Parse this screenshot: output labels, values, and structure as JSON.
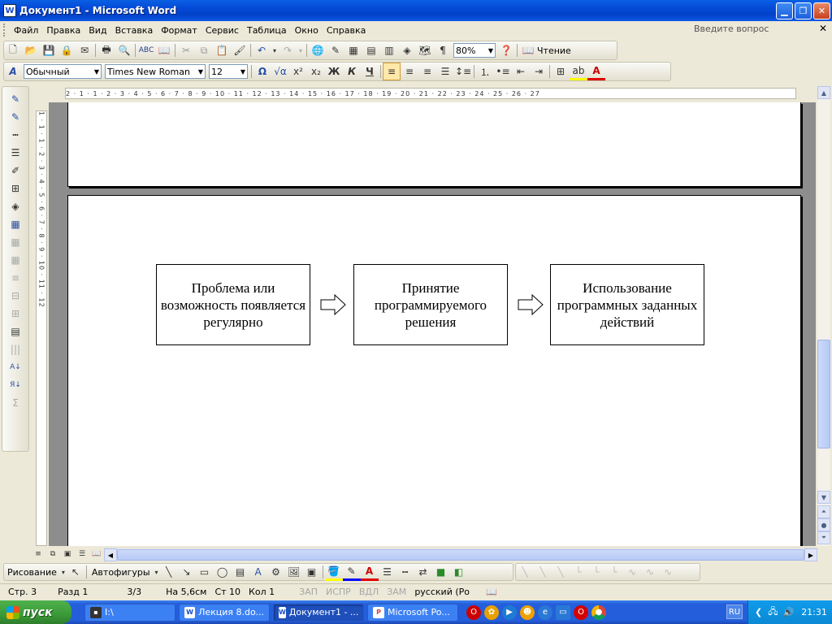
{
  "window": {
    "title": "Документ1 - Microsoft Word",
    "app_icon": "W"
  },
  "menu": {
    "items": [
      "Файл",
      "Правка",
      "Вид",
      "Вставка",
      "Формат",
      "Сервис",
      "Таблица",
      "Окно",
      "Справка"
    ],
    "ask_placeholder": "Введите вопрос"
  },
  "standard_toolbar": {
    "zoom": "80%",
    "reading_label": "Чтение"
  },
  "format_toolbar": {
    "style": "Обычный",
    "font": "Times New Roman",
    "size": "12",
    "bold": "Ж",
    "italic": "К",
    "underline": "Ч"
  },
  "ruler": {
    "horizontal": "2 · 1 · 1 · 2 · 3 · 4 · 5 · 6 · 7 · 8 · 9 · 10 · 11 · 12 · 13 · 14 · 15 · 16 · 17 · 18 · 19 · 20 · 21 · 22 · 23 · 24 · 25 · 26 · 27",
    "vertical": "1 · 1 · 1 · 2 · 3 · 4 · 5 · 6 · 7 · 8 · 9 · 10 · 11 · 12"
  },
  "diagram": {
    "boxes": [
      {
        "text": "Проблема или возможность появляется регулярно"
      },
      {
        "text": "Принятие программируемого решения"
      },
      {
        "text": "Использование программных заданных действий"
      }
    ]
  },
  "drawing_toolbar": {
    "draw_label": "Рисование",
    "autoshapes_label": "Автофигуры"
  },
  "status": {
    "page": "Стр. 3",
    "section": "Разд 1",
    "pages": "3/3",
    "at": "На 5,6см",
    "line": "Ст 10",
    "col": "Кол 1",
    "rec": "ЗАП",
    "trk": "ИСПР",
    "ext": "ВДЛ",
    "ovr": "ЗАМ",
    "language": "русский (Ро"
  },
  "taskbar": {
    "start_label": "пуск",
    "tasks": [
      "I:\\",
      "Лекция 8.do...",
      "Документ1 - ...",
      "Microsoft Po..."
    ],
    "lang": "RU",
    "clock": "21:31"
  }
}
